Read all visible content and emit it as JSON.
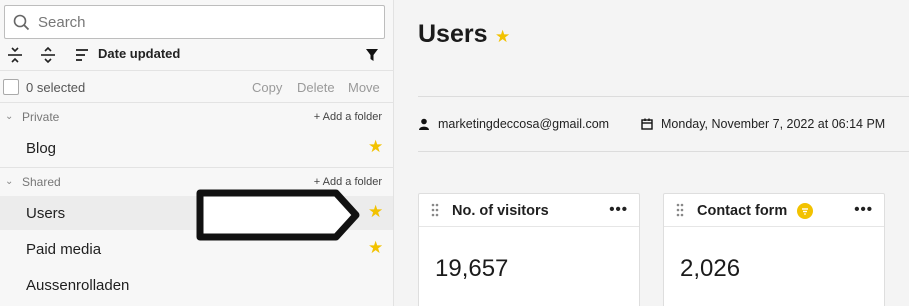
{
  "colors": {
    "accent_star": "#f2c200",
    "sidebar_bg": "#f7f7f7",
    "active_item_bg": "#ececec"
  },
  "search": {
    "placeholder": "Search"
  },
  "toolbar": {
    "sort_label": "Date updated",
    "icons": [
      "collapse-all-icon",
      "expand-all-icon",
      "sort-icon",
      "filter-icon"
    ]
  },
  "selection": {
    "count_label": "0 selected",
    "copy": "Copy",
    "delete": "Delete",
    "move": "Move"
  },
  "sections": {
    "private": {
      "label": "Private",
      "add_folder": "+ Add a folder",
      "items": [
        {
          "label": "Blog",
          "starred": true
        }
      ]
    },
    "shared": {
      "label": "Shared",
      "add_folder": "+ Add a folder",
      "items": [
        {
          "label": "Users",
          "starred": true,
          "active": true
        },
        {
          "label": "Paid media",
          "starred": true
        },
        {
          "label": "Aussenrolladen",
          "starred": false
        }
      ]
    }
  },
  "main": {
    "title": "Users",
    "email": "marketingdeccosa@gmail.com",
    "date": "Monday, November 7, 2022 at 06:14 PM",
    "cards": [
      {
        "title": "No. of visitors",
        "value": "19,657",
        "has_filter": false
      },
      {
        "title": "Contact form",
        "value": "2,026",
        "has_filter": true
      }
    ]
  }
}
